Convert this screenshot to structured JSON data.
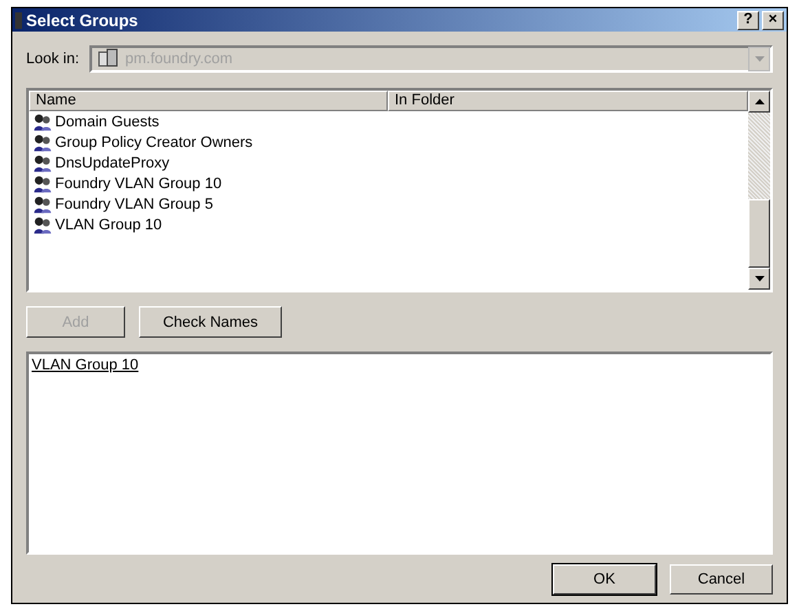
{
  "window": {
    "title": "Select Groups",
    "help_button": "?",
    "close_button": "×"
  },
  "look_in": {
    "label": "Look in:",
    "value": "pm.foundry.com",
    "disabled": true
  },
  "list": {
    "columns": [
      "Name",
      "In Folder"
    ],
    "rows": [
      {
        "name": "Domain Guests",
        "folder": ""
      },
      {
        "name": "Group Policy Creator Owners",
        "folder": ""
      },
      {
        "name": "DnsUpdateProxy",
        "folder": ""
      },
      {
        "name": "Foundry VLAN Group 10",
        "folder": ""
      },
      {
        "name": "Foundry VLAN Group 5",
        "folder": ""
      },
      {
        "name": "VLAN Group 10",
        "folder": ""
      }
    ]
  },
  "buttons": [
    {
      "label": "Add",
      "disabled": true
    },
    {
      "label": "Check Names",
      "disabled": false
    }
  ],
  "selected_names": [
    "VLAN Group 10"
  ],
  "footer_buttons": [
    {
      "label": "OK",
      "default": true
    },
    {
      "label": "Cancel",
      "default": false
    }
  ]
}
